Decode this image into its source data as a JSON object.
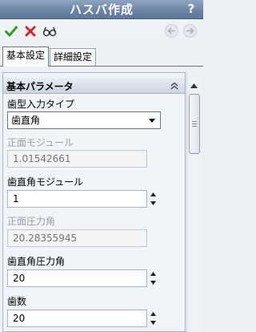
{
  "window": {
    "title": "ハスバ作成",
    "help": "?"
  },
  "toolbar": {
    "ok_icon": "check-icon",
    "cancel_icon": "x-icon",
    "preview_icon": "glasses-icon",
    "back_icon": "back-arrow-icon",
    "forward_icon": "forward-arrow-icon"
  },
  "tabs": [
    {
      "label": "基本設定",
      "active": true
    },
    {
      "label": "詳細設定",
      "active": false
    }
  ],
  "section": {
    "title": "基本パラメータ"
  },
  "fields": {
    "tooth_type": {
      "label": "歯型入力タイプ",
      "value": "歯直角"
    },
    "transverse_module": {
      "label": "正面モジュール",
      "value": "1.01542661"
    },
    "normal_module": {
      "label": "歯直角モジュール",
      "value": "1"
    },
    "transverse_pressure_angle": {
      "label": "正面圧力角",
      "value": "20.28355945"
    },
    "normal_pressure_angle": {
      "label": "歯直角圧力角",
      "value": "20"
    },
    "teeth_count": {
      "label": "歯数",
      "value": "20"
    }
  },
  "colors": {
    "accept": "#2e9b1e",
    "cancel": "#d42424",
    "titlebar": "#6b82a3"
  }
}
